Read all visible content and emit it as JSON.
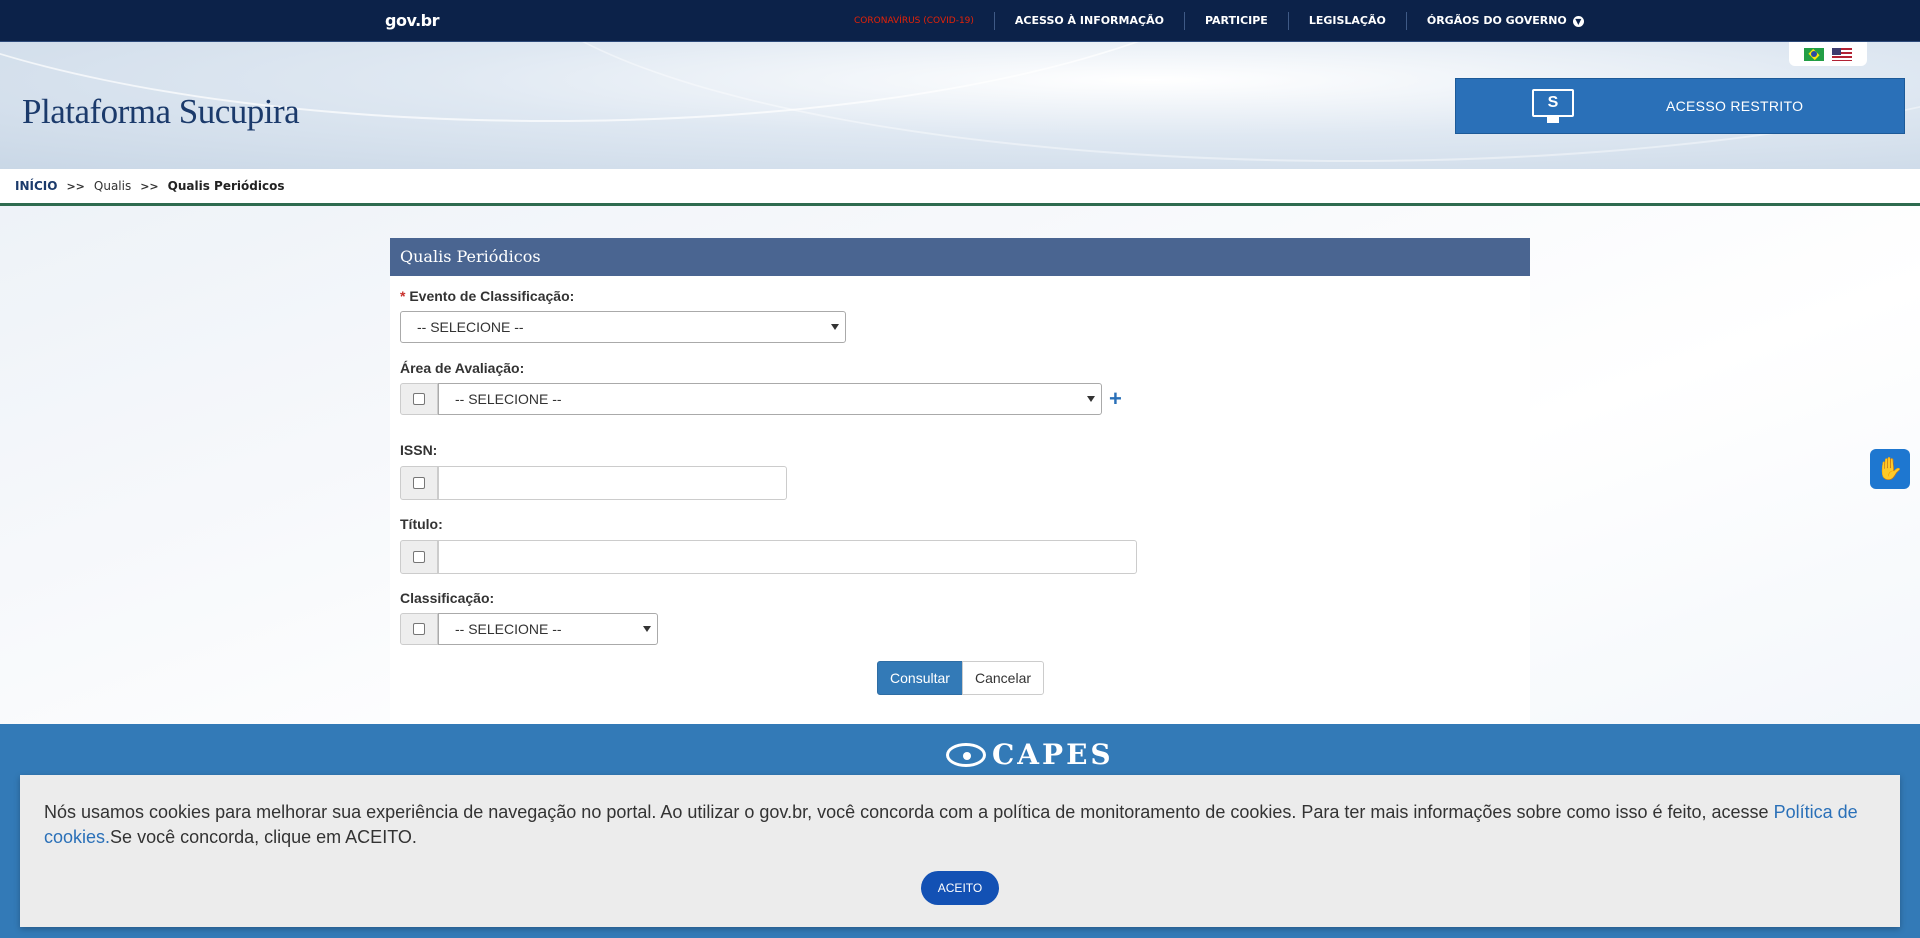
{
  "govbar": {
    "logo": "gov.br",
    "nav": [
      {
        "label": "CORONAVÍRUS (COVID-19)"
      },
      {
        "label": "ACESSO À INFORMAÇÃO"
      },
      {
        "label": "PARTICIPE"
      },
      {
        "label": "LEGISLAÇÃO"
      },
      {
        "label": "ÓRGÃOS DO GOVERNO"
      }
    ]
  },
  "header": {
    "brand": "Plataforma Sucupira",
    "restrito_icon_letter": "S",
    "restrito_label": "ACESSO RESTRITO"
  },
  "breadcrumb": {
    "home": "INÍCIO",
    "separator": ">>",
    "middle": "Qualis",
    "current": "Qualis Periódicos"
  },
  "panel": {
    "title": "Qualis Periódicos",
    "evento_required_mark": "*",
    "evento_label": "Evento de Classificação:",
    "evento_value": "-- SELECIONE --",
    "area_label": "Área de Avaliação:",
    "area_value": "-- SELECIONE --",
    "area_add": "+",
    "issn_label": "ISSN:",
    "issn_value": "",
    "titulo_label": "Título:",
    "titulo_value": "",
    "classificacao_label": "Classificação:",
    "classificacao_value": "-- SELECIONE --",
    "consultar_label": "Consultar",
    "cancelar_label": "Cancelar"
  },
  "footer": {
    "capes_label": "CAPES"
  },
  "cookie": {
    "text_before": "Nós usamos cookies para melhorar sua experiência de navegação no portal. Ao utilizar o gov.br, você concorda com a política de monitoramento de cookies. Para ter mais informações sobre como isso é feito, acesse ",
    "link": "Política de cookies.",
    "text_after": "Se você concorda, clique em ACEITO.",
    "accept_label": "ACEITO"
  },
  "colors": {
    "govbar": "#0c2249",
    "panel_header": "#4a6591",
    "primary": "#337ab7",
    "footer": "#337ab7",
    "accept": "#1351b4",
    "required": "#c9302c",
    "covid": "#e52207"
  }
}
